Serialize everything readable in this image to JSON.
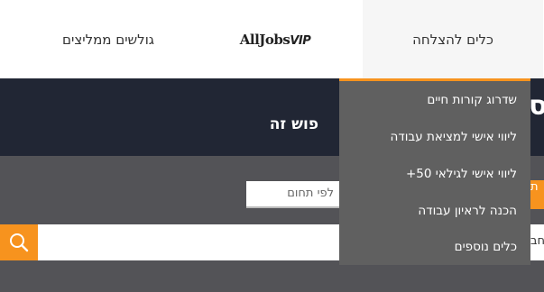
{
  "nav": {
    "tools_label": "כלים להצלחה",
    "logo_text": "AllJobs",
    "logo_vip": "VIP",
    "surfers_label": "גולשים ממליצים"
  },
  "hero": {
    "title": "פוש זה",
    "edge_char": "ס"
  },
  "search": {
    "field_placeholder": "לפי תחום",
    "tab_edge_char": "ת",
    "bar_edge_text": "חב"
  },
  "dropdown": {
    "items": [
      "שדרוג קורות חיים",
      "ליווי אישי למציאת עבודה",
      "ליווי אישי לגילאי 50+",
      "הכנה לראיון עבודה",
      "כלים נוספים"
    ]
  },
  "colors": {
    "accent": "#f7931e",
    "hero_bg": "#212634",
    "dropdown_bg": "#606060"
  },
  "icons": [
    "search-icon"
  ]
}
